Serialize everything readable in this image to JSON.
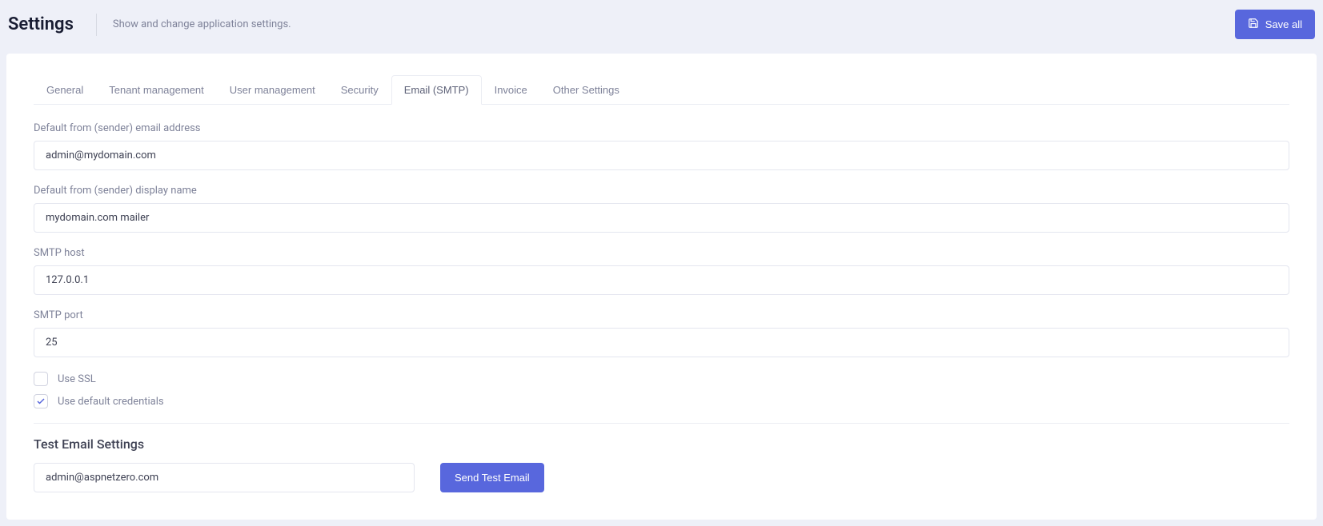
{
  "header": {
    "title": "Settings",
    "subtitle": "Show and change application settings.",
    "save_label": "Save all"
  },
  "tabs": [
    {
      "label": "General",
      "active": false
    },
    {
      "label": "Tenant management",
      "active": false
    },
    {
      "label": "User management",
      "active": false
    },
    {
      "label": "Security",
      "active": false
    },
    {
      "label": "Email (SMTP)",
      "active": true
    },
    {
      "label": "Invoice",
      "active": false
    },
    {
      "label": "Other Settings",
      "active": false
    }
  ],
  "form": {
    "from_email": {
      "label": "Default from (sender) email address",
      "value": "admin@mydomain.com"
    },
    "from_name": {
      "label": "Default from (sender) display name",
      "value": "mydomain.com mailer"
    },
    "smtp_host": {
      "label": "SMTP host",
      "value": "127.0.0.1"
    },
    "smtp_port": {
      "label": "SMTP port",
      "value": "25"
    },
    "use_ssl": {
      "label": "Use SSL",
      "checked": false
    },
    "use_default_creds": {
      "label": "Use default credentials",
      "checked": true
    }
  },
  "test": {
    "title": "Test Email Settings",
    "email_value": "admin@aspnetzero.com",
    "send_label": "Send Test Email"
  }
}
